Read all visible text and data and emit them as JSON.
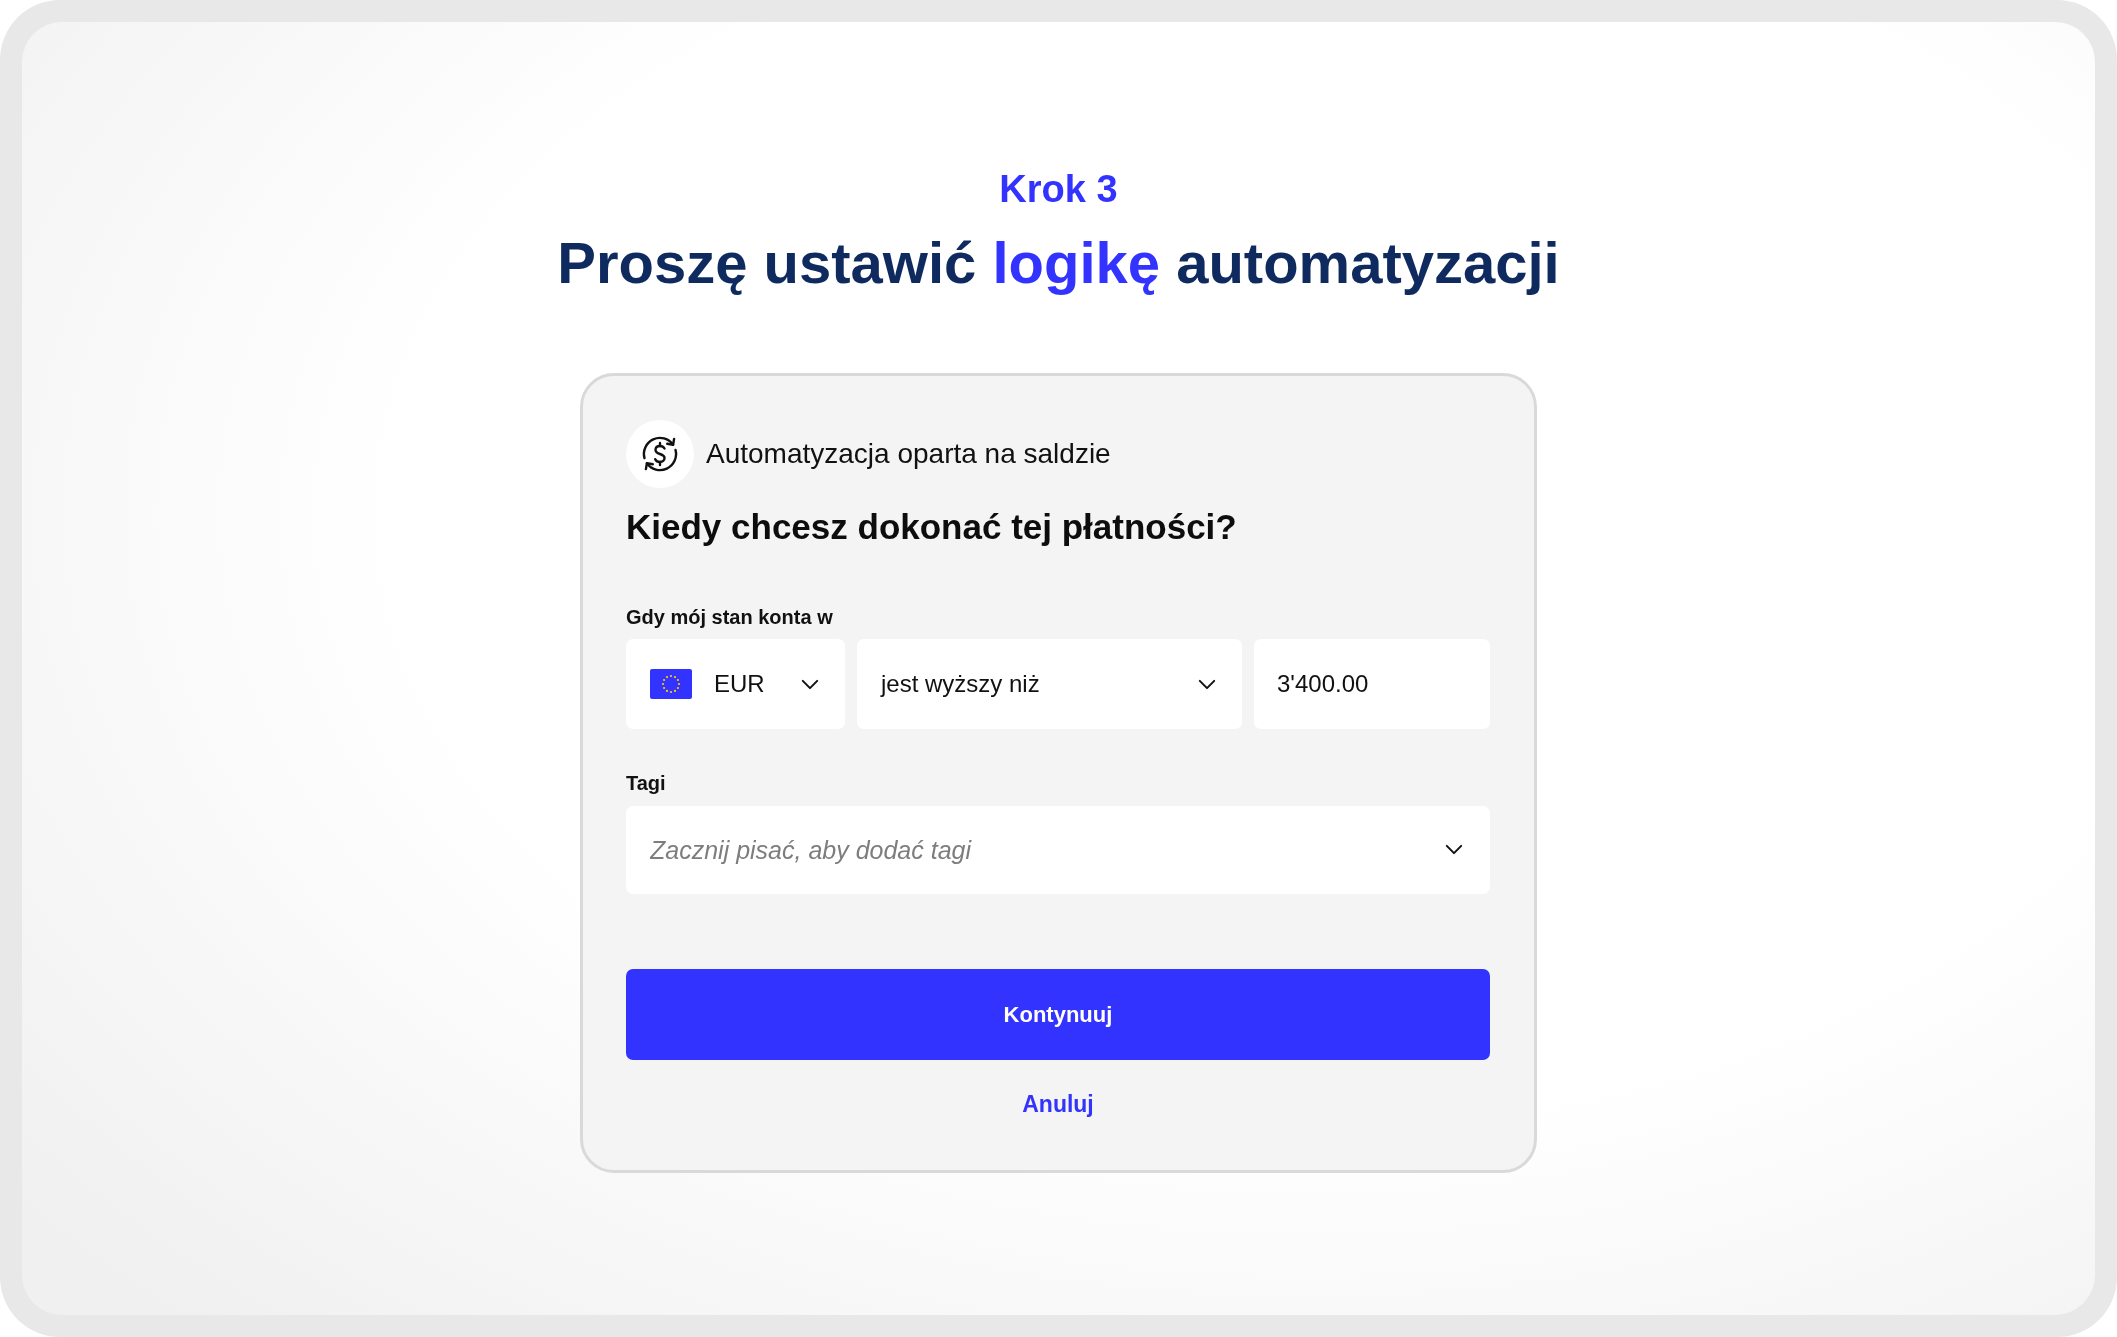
{
  "step": "Krok 3",
  "heading": [
    {
      "text": "Proszę ustawić ",
      "accent": false
    },
    {
      "text": "logikę",
      "accent": true
    },
    {
      "text": " automatyzacji",
      "accent": false
    }
  ],
  "card": {
    "type_label": "Automatyzacja oparta na saldzie",
    "question": "Kiedy chcesz dokonać tej płatności?",
    "condition": {
      "label": "Gdy mój stan konta w",
      "currency": {
        "value": "EUR"
      },
      "comparison": {
        "value": "jest wyższy niż"
      },
      "amount": {
        "value": "3'400.00"
      }
    },
    "tags": {
      "label": "Tagi",
      "placeholder": "Zacznij pisać, aby dodać tagi"
    },
    "buttons": [
      {
        "label": "Kontynuuj",
        "kind": "primary"
      },
      {
        "label": "Anuluj",
        "kind": "link"
      }
    ]
  }
}
